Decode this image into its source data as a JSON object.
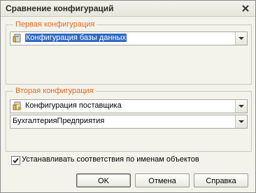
{
  "window": {
    "title": "Сравнение конфигураций"
  },
  "group1": {
    "title": "Первая конфигурация",
    "combo": {
      "value": "Конфигурация базы данных",
      "icon": "database-config-icon"
    }
  },
  "group2": {
    "title": "Вторая конфигурация",
    "combo1": {
      "value": "Конфигурация поставщика",
      "icon": "supplier-config-icon"
    },
    "combo2": {
      "value": "БухгалтерияПредприятия"
    }
  },
  "checkbox": {
    "label": "Устанавливать соответствия по именам объектов",
    "checked": true
  },
  "buttons": {
    "ok": "OK",
    "cancel": "Отмена",
    "help": "Справка"
  }
}
